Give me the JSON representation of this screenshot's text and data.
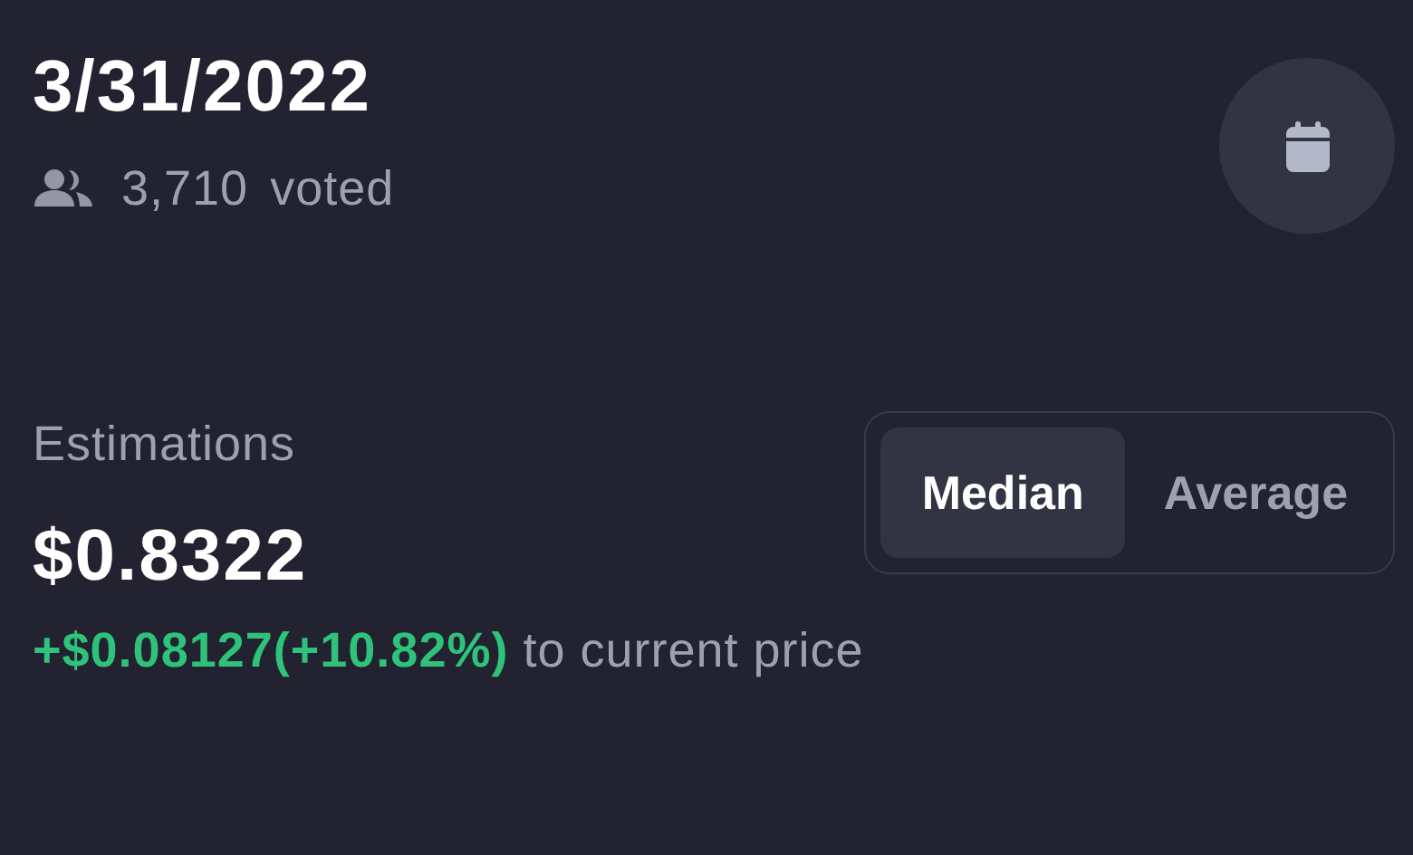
{
  "header": {
    "date": "3/31/2022",
    "vote_count": "3,710",
    "vote_label": "voted"
  },
  "estimations": {
    "label": "Estimations",
    "value": "$0.8322",
    "change": "+$0.08127(+10.82%)",
    "change_suffix": "to current price"
  },
  "toggle": [
    {
      "label": "Median",
      "selected": true
    },
    {
      "label": "Average",
      "selected": false
    }
  ]
}
